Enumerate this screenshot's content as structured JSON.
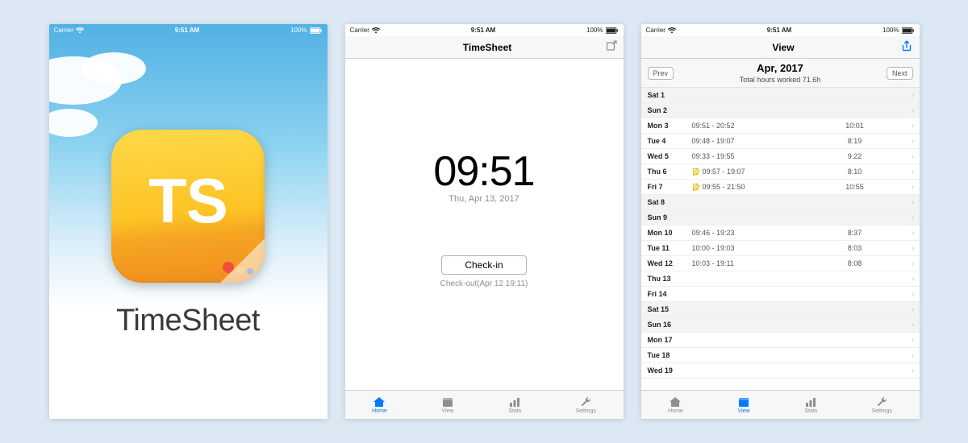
{
  "status": {
    "carrier": "Carrier",
    "time": "9:51 AM",
    "battery": "100%"
  },
  "splash": {
    "icon_letters": "TS",
    "app_name": "TimeSheet"
  },
  "checkin": {
    "nav_title": "TimeSheet",
    "clock_time": "09:51",
    "clock_date": "Thu, Apr 13, 2017",
    "button_label": "Check-in",
    "last_checkout": "Check-out(Apr 12 19:11)"
  },
  "tabs": {
    "items": [
      {
        "label": "Home"
      },
      {
        "label": "View"
      },
      {
        "label": "Stats"
      },
      {
        "label": "Settings"
      }
    ]
  },
  "view": {
    "nav_title": "View",
    "prev_label": "Prev",
    "next_label": "Next",
    "month_label": "Apr, 2017",
    "total_label": "Total hours worked 71.6h",
    "entries": [
      {
        "day": "Sat 1",
        "times": "",
        "dur": "",
        "wend": true
      },
      {
        "day": "Sun 2",
        "times": "",
        "dur": "",
        "wend": true
      },
      {
        "day": "Mon 3",
        "times": "09:51 - 20:52",
        "dur": "10:01"
      },
      {
        "day": "Tue 4",
        "times": "09:48 - 19:07",
        "dur": "8:19"
      },
      {
        "day": "Wed 5",
        "times": "09:33 - 19:55",
        "dur": "9:22"
      },
      {
        "day": "Thu 6",
        "times": "09:57 - 19:07",
        "dur": "8:10",
        "note": true
      },
      {
        "day": "Fri 7",
        "times": "09:55 - 21:50",
        "dur": "10:55",
        "note": true
      },
      {
        "day": "Sat 8",
        "times": "",
        "dur": "",
        "wend": true
      },
      {
        "day": "Sun 9",
        "times": "",
        "dur": "",
        "wend": true
      },
      {
        "day": "Mon 10",
        "times": "09:46 - 19:23",
        "dur": "8:37"
      },
      {
        "day": "Tue 11",
        "times": "10:00 - 19:03",
        "dur": "8:03"
      },
      {
        "day": "Wed 12",
        "times": "10:03 - 19:11",
        "dur": "8:08"
      },
      {
        "day": "Thu 13",
        "times": "",
        "dur": ""
      },
      {
        "day": "Fri 14",
        "times": "",
        "dur": ""
      },
      {
        "day": "Sat 15",
        "times": "",
        "dur": "",
        "wend": true
      },
      {
        "day": "Sun 16",
        "times": "",
        "dur": "",
        "wend": true
      },
      {
        "day": "Mon 17",
        "times": "",
        "dur": ""
      },
      {
        "day": "Tue 18",
        "times": "",
        "dur": ""
      },
      {
        "day": "Wed 19",
        "times": "",
        "dur": ""
      }
    ]
  }
}
